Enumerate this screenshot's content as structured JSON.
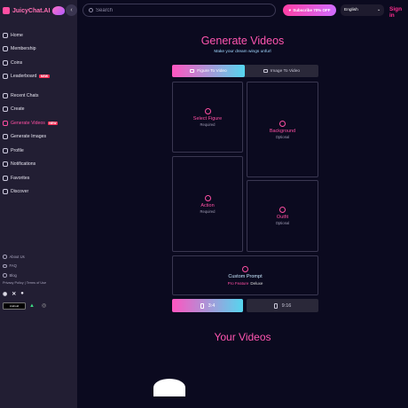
{
  "brand": {
    "name": "JuicyChat.AI"
  },
  "sidebar": {
    "items": [
      {
        "label": "Home",
        "icon": "home-icon"
      },
      {
        "label": "Membership",
        "icon": "heart-icon"
      },
      {
        "label": "Coins",
        "icon": "coin-icon"
      },
      {
        "label": "Leaderboard",
        "icon": "trophy-icon",
        "badge": "NEW"
      },
      {
        "label": "Recent Chats",
        "icon": "chat-icon"
      },
      {
        "label": "Create",
        "icon": "plus-icon"
      },
      {
        "label": "Generate Videos",
        "icon": "video-icon",
        "badge": "NEW",
        "active": true
      },
      {
        "label": "Generate Images",
        "icon": "image-icon"
      },
      {
        "label": "Profile",
        "icon": "user-icon"
      },
      {
        "label": "Notifications",
        "icon": "bell-icon"
      },
      {
        "label": "Favorites",
        "icon": "star-icon"
      },
      {
        "label": "Discover",
        "icon": "compass-icon"
      }
    ],
    "footer": {
      "about": "About Us",
      "faq": "FAQ",
      "blog": "Blog",
      "privacy": "Privacy Policy",
      "separator": "|",
      "terms": "Terms of Use",
      "android": "Android",
      "ios": "App Store"
    }
  },
  "header": {
    "search_placeholder": "Search",
    "subscribe": "Subscribe 70% OFF",
    "language": "English",
    "signin": "Sign in"
  },
  "main": {
    "title": "Generate Videos",
    "subtitle": "Make your dream wings unfurl",
    "tabs": [
      "Figure To Video",
      "Image To Video"
    ],
    "cards": {
      "figure": {
        "label": "Select Figure",
        "sub": "Required"
      },
      "background": {
        "label": "Background",
        "sub": "Optional"
      },
      "action": {
        "label": "Action",
        "sub": "Required"
      },
      "outfit": {
        "label": "Outfit",
        "sub": "Optional"
      },
      "prompt": {
        "label": "Custom Prompt",
        "pro": "Pro Feature",
        "deluxe": "Deluxe"
      }
    },
    "ratios": [
      "3:4",
      "9:16"
    ],
    "your_videos": "Your Videos"
  },
  "colors": {
    "accent": "#ff4fa3",
    "gradient_end": "#55d6ef",
    "background": "#0b0a1f",
    "sidebar": "#221e33"
  }
}
